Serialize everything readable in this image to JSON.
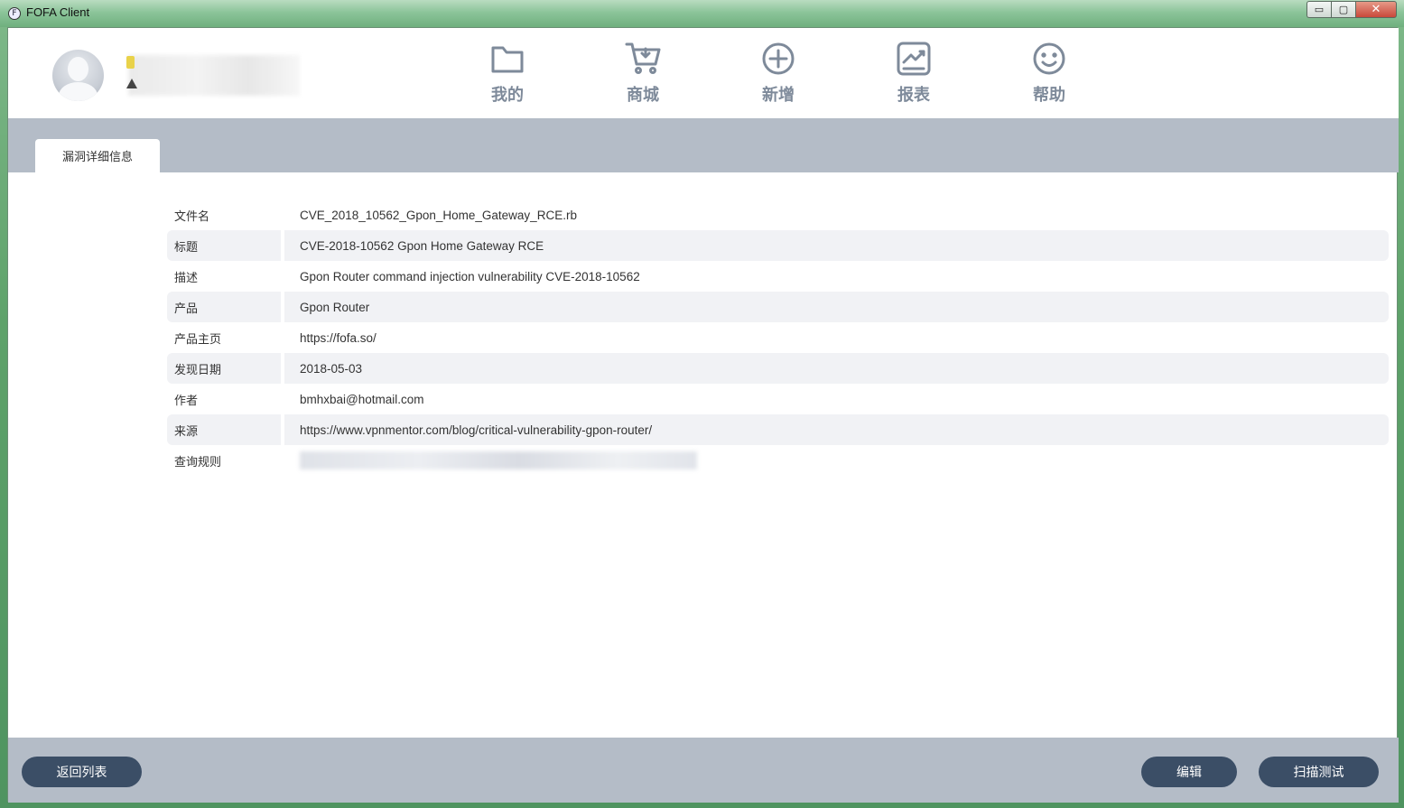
{
  "window": {
    "title": "FOFA Client",
    "app_icon": "fofa-logo-icon"
  },
  "window_controls": {
    "minimize": "▭",
    "maximize": "▢",
    "close": "✕"
  },
  "nav": [
    {
      "label": "我的",
      "icon": "folder-icon"
    },
    {
      "label": "商城",
      "icon": "shopping-cart-icon"
    },
    {
      "label": "新增",
      "icon": "plus-circle-icon"
    },
    {
      "label": "报表",
      "icon": "chart-report-icon"
    },
    {
      "label": "帮助",
      "icon": "smiley-icon"
    }
  ],
  "tab": {
    "label": "漏洞详细信息"
  },
  "details": [
    {
      "key": "文件名",
      "value": "CVE_2018_10562_Gpon_Home_Gateway_RCE.rb"
    },
    {
      "key": "标题",
      "value": "CVE-2018-10562 Gpon Home Gateway RCE"
    },
    {
      "key": "描述",
      "value": "Gpon Router command injection vulnerability CVE-2018-10562"
    },
    {
      "key": "产品",
      "value": "Gpon Router"
    },
    {
      "key": "产品主页",
      "value": "https://fofa.so/"
    },
    {
      "key": "发现日期",
      "value": "2018-05-03"
    },
    {
      "key": "作者",
      "value": "bmhxbai@hotmail.com"
    },
    {
      "key": "来源",
      "value": "https://www.vpnmentor.com/blog/critical-vulnerability-gpon-router/"
    },
    {
      "key": "查询规则",
      "value": ""
    }
  ],
  "footer": {
    "back_label": "返回列表",
    "edit_label": "编辑",
    "scan_label": "扫描测试"
  },
  "colors": {
    "nav_icon": "#7e8a9a",
    "band": "#b4bcc7",
    "button": "#3b4e66",
    "row_alt": "#f1f2f5"
  }
}
